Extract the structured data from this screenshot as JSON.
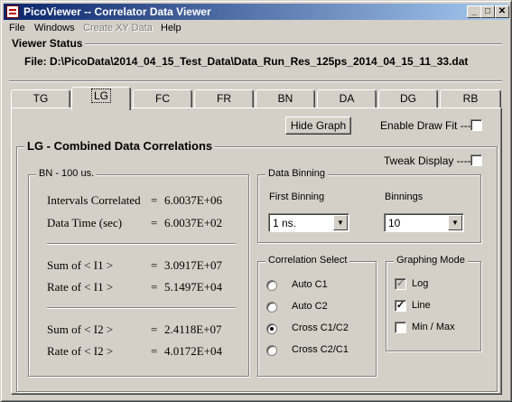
{
  "window": {
    "title": "PicoViewer -- Correlator Data Viewer",
    "controls": {
      "minimize": "_",
      "maximize": "□",
      "close": "✕"
    }
  },
  "menu": {
    "file": "File",
    "windows": "Windows",
    "create_xy": "Create XY Data",
    "help": "Help"
  },
  "viewer_status": {
    "title": "Viewer  Status",
    "file_text": "File: D:\\PicoData\\2014_04_15_Test_Data\\Data_Run_Res_125ps_2014_04_15_11_33.dat"
  },
  "tabs": [
    {
      "label": "TG"
    },
    {
      "label": "LG"
    },
    {
      "label": "FC"
    },
    {
      "label": "FR"
    },
    {
      "label": "BN"
    },
    {
      "label": "DA"
    },
    {
      "label": "DG"
    },
    {
      "label": "RB"
    }
  ],
  "active_tab": "LG",
  "top_controls": {
    "hide_graph": "Hide Graph",
    "enable_draw_fit": "Enable Draw Fit ----"
  },
  "main_group": {
    "title": "LG - Combined Data Correlations",
    "tweak_display": "Tweak Display ----"
  },
  "bn_group": {
    "title": "BN - 100 us.",
    "rows": [
      {
        "label": "Intervals Correlated",
        "eq": "=",
        "value": "6.0037E+06"
      },
      {
        "label": "Data Time (sec)",
        "eq": "=",
        "value": "6.0037E+02"
      },
      {
        "label": "Sum  of  < I1 >",
        "eq": "=",
        "value": "3.0917E+07"
      },
      {
        "label": "Rate  of  < I1 >",
        "eq": "=",
        "value": "5.1497E+04"
      },
      {
        "label": "Sum  of  < I2 >",
        "eq": "=",
        "value": "2.4118E+07"
      },
      {
        "label": "Rate  of  < I2 >",
        "eq": "=",
        "value": "4.0172E+04"
      }
    ]
  },
  "data_binning": {
    "title": "Data Binning",
    "first_binning_label": "First Binning",
    "first_binning_value": "1 ns.",
    "binnings_label": "Binnings",
    "binnings_value": "10"
  },
  "correlation_select": {
    "title": "Correlation Select",
    "options": [
      {
        "label": "Auto  C1",
        "selected": false
      },
      {
        "label": "Auto  C2",
        "selected": false
      },
      {
        "label": "Cross C1/C2",
        "selected": true
      },
      {
        "label": "Cross C2/C1",
        "selected": false
      }
    ]
  },
  "graphing_mode": {
    "title": "Graphing  Mode",
    "options": [
      {
        "label": "Log",
        "checked": true,
        "disabled": true
      },
      {
        "label": "Line",
        "checked": true,
        "disabled": false
      },
      {
        "label": "Min / Max",
        "checked": false,
        "disabled": false
      }
    ]
  },
  "glyphs": {
    "check": "✓",
    "dropdown_arrow": "▼"
  }
}
